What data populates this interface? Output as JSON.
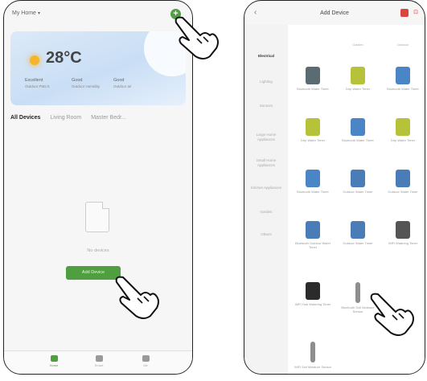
{
  "left": {
    "home_title": "My Home",
    "add_icon_glyph": "+",
    "weather": {
      "temperature": "28°C",
      "stats": [
        {
          "label": "Excellent",
          "value": "Outdoor PM2.5"
        },
        {
          "label": "Good",
          "value": "Outdoor Humidity"
        },
        {
          "label": "Good",
          "value": "Outdoor air"
        }
      ]
    },
    "tabs": [
      "All Devices",
      "Living Room",
      "Master Bedr..."
    ],
    "empty_text": "No devices",
    "add_device_label": "Add Device",
    "nav": [
      "Home",
      "Smart",
      "Me"
    ]
  },
  "right": {
    "title": "Add Device",
    "categories": [
      "Electrical",
      "Lighting",
      "Sensors",
      "Large Home Appliances",
      "Small Home Appliances",
      "Kitchen Appliances",
      "Garden",
      "Others"
    ],
    "col_heads": [
      "",
      "Garden",
      "Outdoor"
    ],
    "devices": [
      {
        "label": "Bluetooth Water Timer",
        "icon": "garden-valve-icon"
      },
      {
        "label": "Drip Water Timer",
        "icon": "drip-timer-icon"
      },
      {
        "label": "Bluetooth Water Timer",
        "icon": "water-timer-icon"
      },
      {
        "label": "Drip Water Timer",
        "icon": "drip-timer-icon"
      },
      {
        "label": "Bluetooth Water Timer",
        "icon": "water-timer-icon"
      },
      {
        "label": "Drip Water Timer",
        "icon": "drip-timer-icon"
      },
      {
        "label": "Bluetooth Water Timer",
        "icon": "water-timer-icon"
      },
      {
        "label": "Outdoor Water Timer",
        "icon": "outdoor-timer-icon"
      },
      {
        "label": "Outdoor Water Timer",
        "icon": "outdoor-timer-icon"
      },
      {
        "label": "Bluetooth Outdoor Water Timer",
        "icon": "outdoor-timer-icon"
      },
      {
        "label": "Outdoor Water Timer",
        "icon": "outdoor-timer-icon"
      },
      {
        "label": "WiFi Watering Timer",
        "icon": "wifi-timer-icon"
      },
      {
        "label": "WiFi Hub Watering Timer",
        "icon": "hub-icon"
      },
      {
        "label": "Bluetooth Soil Moisture Sensor",
        "icon": "soil-sensor-icon"
      },
      {
        "label": "",
        "icon": "blank"
      },
      {
        "label": "WiFi Soil Moisture Sensor",
        "icon": "soil-sensor-icon"
      }
    ]
  },
  "colors": {
    "accent": "#4f9e3f",
    "danger": "#d9463f"
  }
}
